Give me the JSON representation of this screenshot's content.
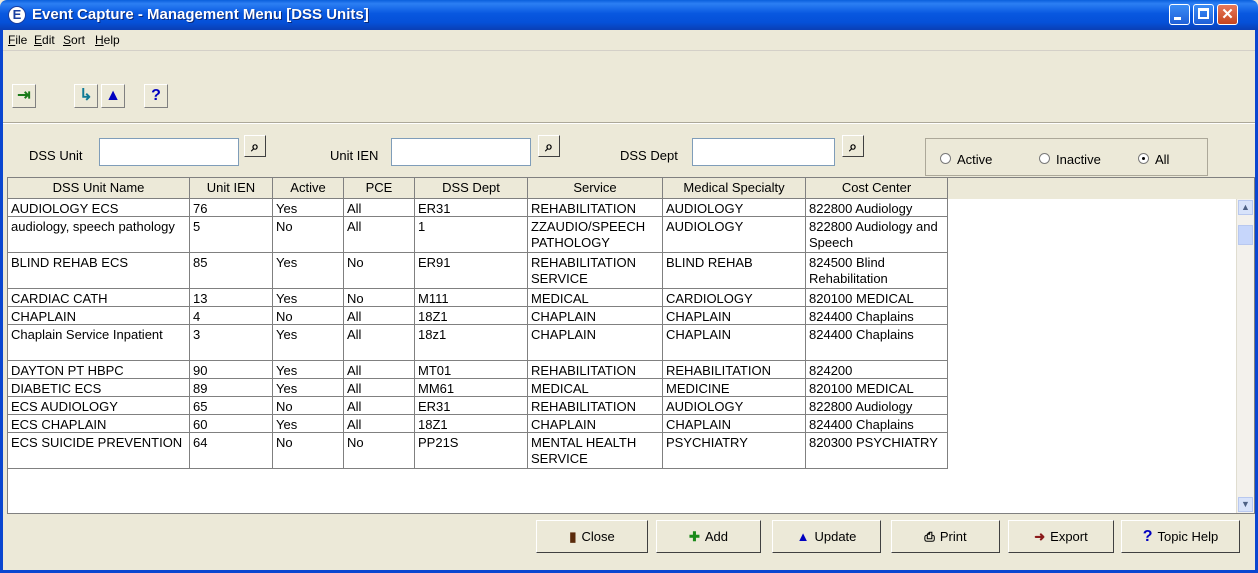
{
  "window": {
    "title": "Event Capture - Management Menu [DSS Units]",
    "app_icon_letter": "E",
    "close_glyph": "✕"
  },
  "menu": [
    "File",
    "Edit",
    "Sort",
    "Help"
  ],
  "toolbar": {
    "buttons": [
      {
        "name": "exit-icon",
        "glyph": "⇥"
      },
      {
        "name": "add-row-icon",
        "glyph": "↳"
      },
      {
        "name": "update-icon",
        "glyph": "▲"
      },
      {
        "name": "help-icon",
        "glyph": "?"
      }
    ]
  },
  "filters": {
    "dss_unit_label": "DSS Unit",
    "dss_unit_value": "",
    "unit_ien_label": "Unit IEN",
    "unit_ien_value": "",
    "dss_dept_label": "DSS Dept",
    "dss_dept_value": "",
    "find_glyph": "⌕"
  },
  "status_filter": {
    "options": [
      "Active",
      "Inactive",
      "All"
    ],
    "selected": "All"
  },
  "table": {
    "columns": [
      "DSS Unit Name",
      "Unit IEN",
      "Active",
      "PCE",
      "DSS Dept",
      "Service",
      "Medical Specialty",
      "Cost Center"
    ],
    "rows": [
      [
        "AUDIOLOGY ECS",
        "76",
        "Yes",
        "All",
        "ER31",
        "REHABILITATION",
        "AUDIOLOGY",
        "822800 Audiology"
      ],
      [
        "audiology, speech pathology",
        "5",
        "No",
        "All",
        "1",
        "ZZAUDIO/SPEECH PATHOLOGY",
        "AUDIOLOGY",
        "822800 Audiology and Speech"
      ],
      [
        "BLIND REHAB ECS",
        "85",
        "Yes",
        "No",
        "ER91",
        "REHABILITATION SERVICE",
        "BLIND REHAB",
        "824500 Blind Rehabilitation"
      ],
      [
        "CARDIAC CATH",
        "13",
        "Yes",
        "No",
        "M111",
        "MEDICAL",
        "CARDIOLOGY",
        "820100 MEDICAL"
      ],
      [
        "CHAPLAIN",
        "4",
        "No",
        "All",
        "18Z1",
        "CHAPLAIN",
        "CHAPLAIN",
        "824400 Chaplains"
      ],
      [
        "Chaplain Service Inpatient",
        "3",
        "Yes",
        "All",
        "18z1",
        "CHAPLAIN",
        "CHAPLAIN",
        "824400 Chaplains"
      ],
      [
        "DAYTON PT HBPC",
        "90",
        "Yes",
        "All",
        "MT01",
        "REHABILITATION",
        "REHABILITATION",
        "824200"
      ],
      [
        "DIABETIC ECS",
        "89",
        "Yes",
        "All",
        "MM61",
        "MEDICAL",
        "MEDICINE",
        "820100 MEDICAL"
      ],
      [
        "ECS AUDIOLOGY",
        "65",
        "No",
        "All",
        "ER31",
        "REHABILITATION",
        "AUDIOLOGY",
        "822800 Audiology"
      ],
      [
        "ECS CHAPLAIN",
        "60",
        "Yes",
        "All",
        "18Z1",
        "CHAPLAIN",
        "CHAPLAIN",
        "824400 Chaplains"
      ],
      [
        "ECS SUICIDE PREVENTION",
        "64",
        "No",
        "No",
        "PP21S",
        "MENTAL HEALTH SERVICE",
        "PSYCHIATRY",
        "820300 PSYCHIATRY"
      ]
    ],
    "scroll_up_glyph": "▲",
    "scroll_down_glyph": "▼"
  },
  "buttons": [
    {
      "name": "close-button",
      "icon_name": "door-icon",
      "icon": "▮",
      "label": "Close"
    },
    {
      "name": "add-button",
      "icon_name": "plus-icon",
      "icon": "✚",
      "label": "Add"
    },
    {
      "name": "update-button",
      "icon_name": "triangle-icon",
      "icon": "▲",
      "label": "Update"
    },
    {
      "name": "print-button",
      "icon_name": "printer-icon",
      "icon": "⎙",
      "label": "Print"
    },
    {
      "name": "export-button",
      "icon_name": "export-icon",
      "icon": "➜",
      "label": "Export"
    },
    {
      "name": "topic-help-button",
      "icon_name": "question-icon",
      "icon": "?",
      "label": "Topic Help"
    }
  ]
}
